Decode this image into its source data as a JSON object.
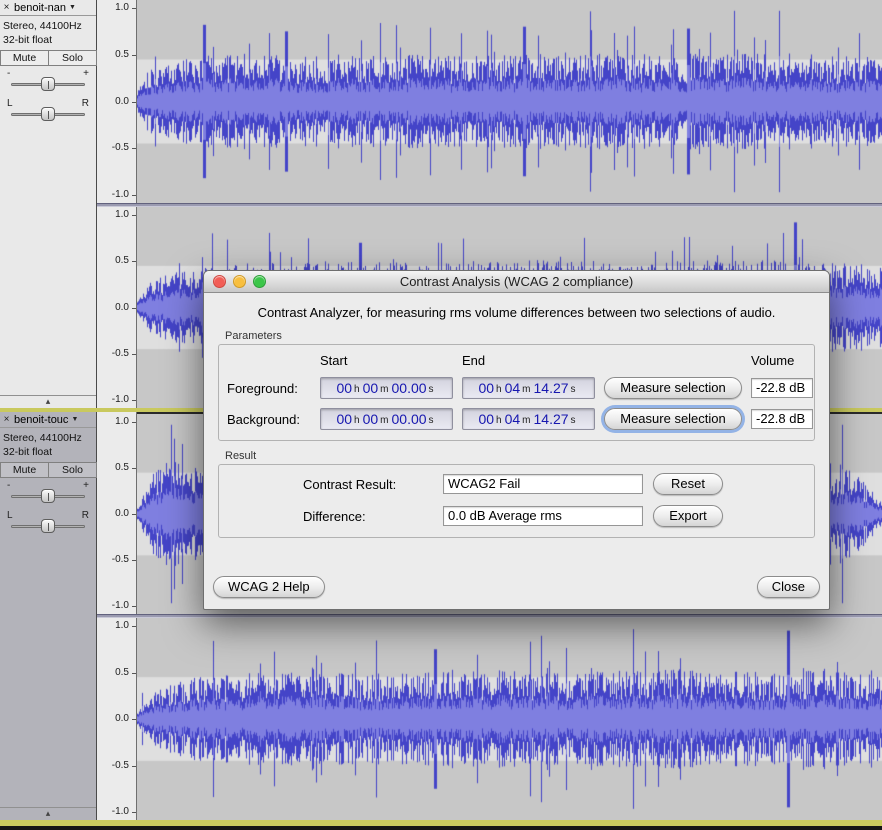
{
  "glyphs": {
    "close": "×",
    "caret": "▼",
    "collapse": "▴",
    "gain_minus": "-",
    "gain_plus": "+",
    "pan_left": "L",
    "pan_right": "R"
  },
  "ruler_labels": [
    "1.0",
    "0.5",
    "0.0",
    "-0.5",
    "-1.0"
  ],
  "tracks": [
    {
      "name": "benoit-nan",
      "info1": "Stereo, 44100Hz",
      "info2": "32-bit float",
      "mute_label": "Mute",
      "solo_label": "Solo"
    },
    {
      "name": "benoit-touc",
      "info1": "Stereo, 44100Hz",
      "info2": "32-bit float",
      "mute_label": "Mute",
      "solo_label": "Solo"
    }
  ],
  "dialog": {
    "title": "Contrast Analysis (WCAG 2 compliance)",
    "intro": "Contrast Analyzer, for measuring rms volume differences between two selections of audio.",
    "parameters": {
      "label": "Parameters",
      "columns": {
        "start": "Start",
        "end": "End",
        "volume": "Volume"
      },
      "rows": [
        {
          "label": "Foreground:",
          "start": [
            {
              "v": "00",
              "u": "h"
            },
            {
              "v": "00",
              "u": "m"
            },
            {
              "v": "00.00",
              "u": "s"
            }
          ],
          "end": [
            {
              "v": "00",
              "u": "h"
            },
            {
              "v": "04",
              "u": "m"
            },
            {
              "v": "14.27",
              "u": "s"
            }
          ],
          "measure_label": "Measure selection",
          "volume": "-22.8 dB"
        },
        {
          "label": "Background:",
          "start": [
            {
              "v": "00",
              "u": "h"
            },
            {
              "v": "00",
              "u": "m"
            },
            {
              "v": "00.00",
              "u": "s"
            }
          ],
          "end": [
            {
              "v": "00",
              "u": "h"
            },
            {
              "v": "04",
              "u": "m"
            },
            {
              "v": "14.27",
              "u": "s"
            }
          ],
          "measure_label": "Measure selection",
          "volume": "-22.8 dB"
        }
      ]
    },
    "result": {
      "label": "Result",
      "rows": [
        {
          "label": "Contrast Result:",
          "value": "WCAG2 Fail",
          "button": "Reset"
        },
        {
          "label": "Difference:",
          "value": "0.0 dB Average rms",
          "button": "Export"
        }
      ]
    },
    "help_label": "WCAG 2 Help",
    "close_label": "Close"
  },
  "colors": {
    "wave_blue": "#4444c8",
    "wave_rms": "#7f7fe0",
    "selection_gray": "#c7c7c7",
    "selection_band": "#dfdfdf",
    "focus_yellow": "#c9c95e"
  }
}
